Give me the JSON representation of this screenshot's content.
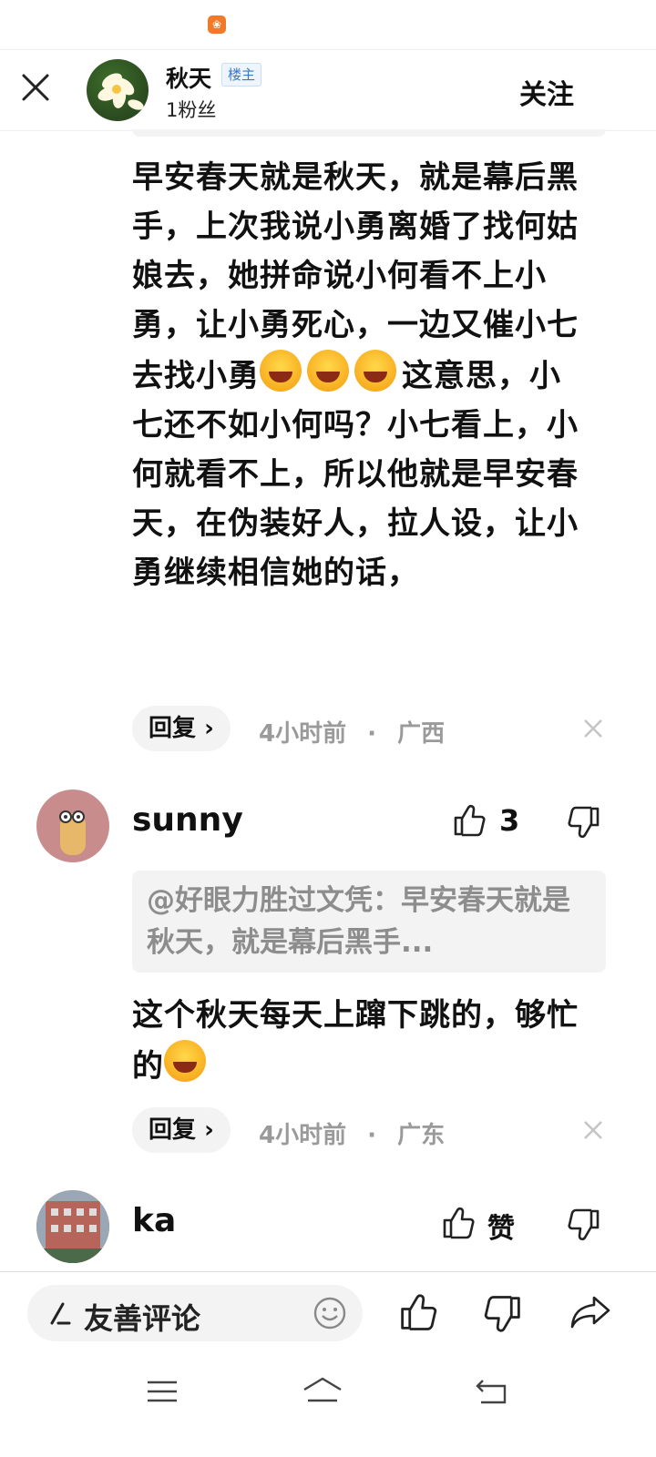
{
  "status_bar": {
    "app_icon": "app-notification-icon"
  },
  "header": {
    "name": "秋天",
    "badge": "楼主",
    "fans": "1粉丝",
    "follow_label": "关注"
  },
  "comments": [
    {
      "text_part1": "早安春天就是秋天，就是幕后黑手，上次我说小勇离婚了找何姑娘去，她拼命说小何看不上小勇，让小勇死心，一边又催小七去找小勇",
      "text_part2": "这意思，小七还不如小何吗？小七看上，小何就看不上，所以他就是早安春天，在伪装好人，拉人设，让小勇继续相信她的话，",
      "reply_label": "回复",
      "time": "4小时前",
      "dot": "·",
      "location": "广西"
    },
    {
      "username": "sunny",
      "likes": "3",
      "quote": "@好眼力胜过文凭：早安春天就是秋天，就是幕后黑手...",
      "text": "这个秋天每天上蹿下跳的，够忙的",
      "reply_label": "回复",
      "time": "4小时前",
      "dot": "·",
      "location": "广东"
    },
    {
      "username": "ka",
      "like_label": "赞"
    }
  ],
  "bottom_bar": {
    "input_placeholder": "友善评论"
  },
  "colors": {
    "accent_badge": "#3a78c8",
    "meta_gray": "#9a9a9a",
    "app_icon": "#f07a2a"
  }
}
